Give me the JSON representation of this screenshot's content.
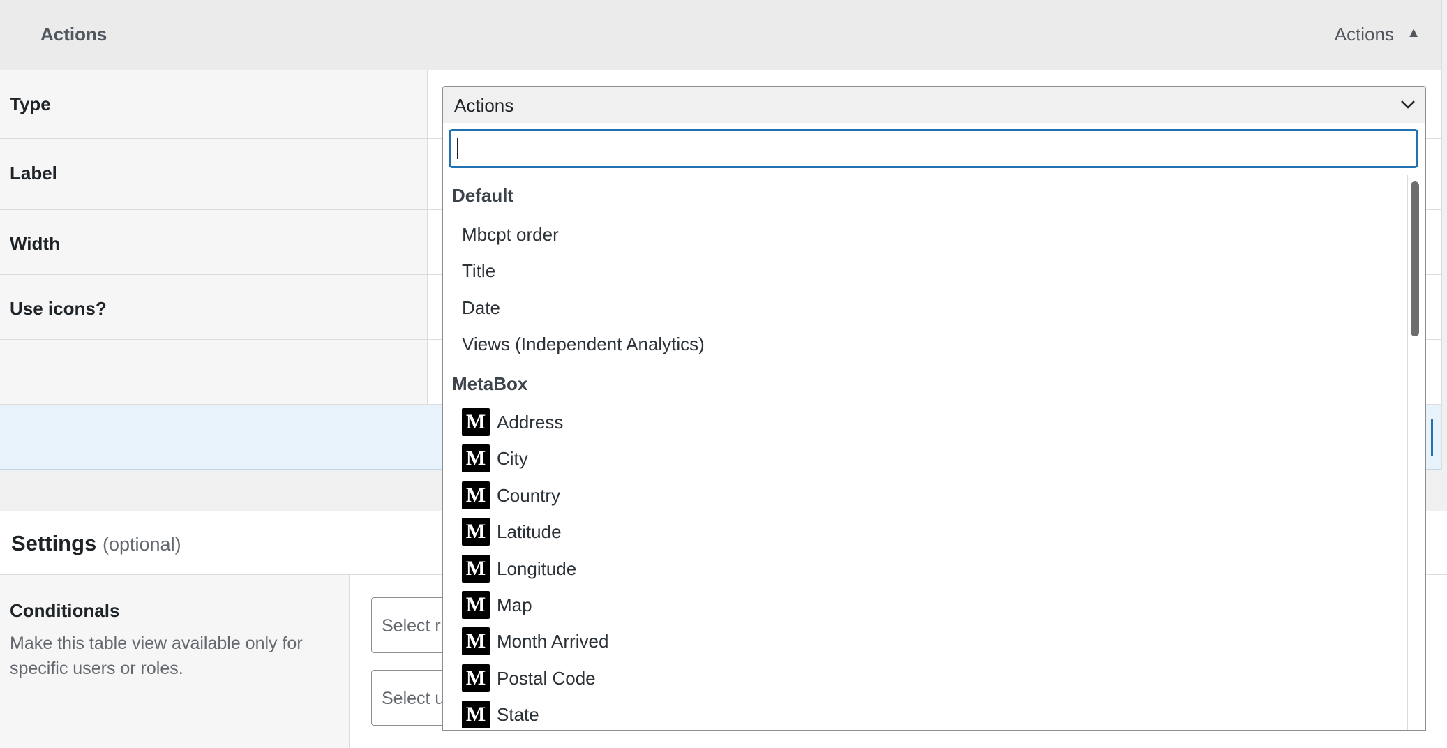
{
  "column": {
    "header_title": "Actions",
    "header_right_label": "Actions",
    "toggle_icon": "caret-up-icon",
    "rows": [
      {
        "label": "Type"
      },
      {
        "label": "Label"
      },
      {
        "label": "Width"
      },
      {
        "label": "Use icons?"
      }
    ]
  },
  "type_select": {
    "value": "Actions",
    "icon": "chevron-down-icon"
  },
  "dropdown": {
    "search_value": "",
    "groups": [
      {
        "label": "Default",
        "options": [
          "Mbcpt order",
          "Title",
          "Date",
          "Views (Independent Analytics)"
        ]
      },
      {
        "label": "MetaBox",
        "icon": "metabox-m-icon",
        "icon_letter": "M",
        "options": [
          "Address",
          "City",
          "Country",
          "Latitude",
          "Longitude",
          "Map",
          "Month Arrived",
          "Postal Code",
          "State"
        ]
      }
    ]
  },
  "settings": {
    "title": "Settings",
    "optional": "(optional)",
    "conditionals_title": "Conditionals",
    "conditionals_description": "Make this table view available only for specific users or roles.",
    "select_1": "Select r",
    "select_2": "Select u"
  }
}
